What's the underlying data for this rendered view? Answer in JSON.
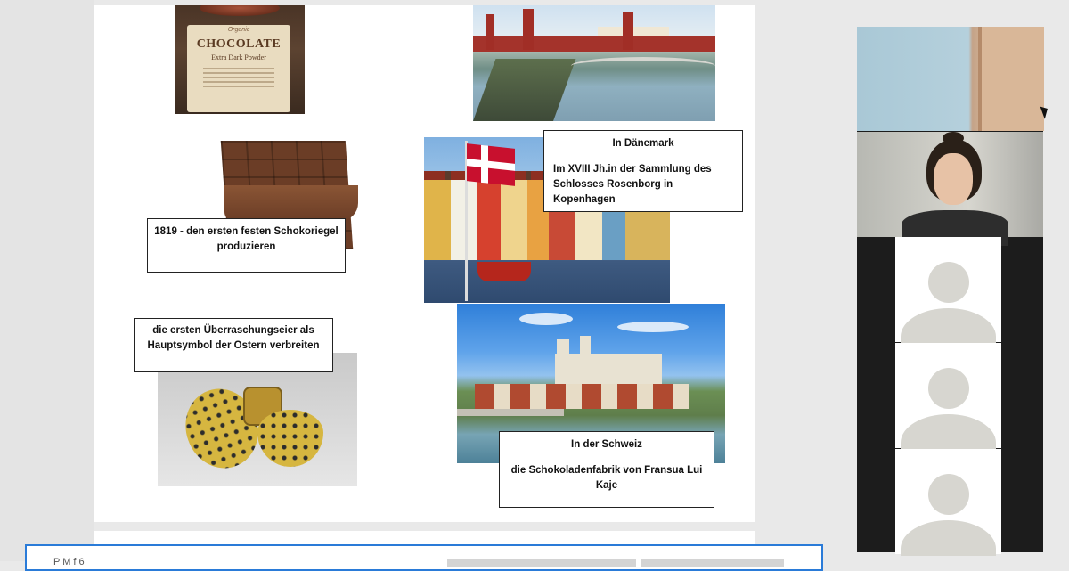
{
  "slide": {
    "chocolate_package": {
      "brand": "Organic",
      "title": "CHOCOLATE",
      "subtitle": "Extra Dark Powder"
    },
    "captions": {
      "bar_1819": "1819 - den ersten festen Schokoriegel produzieren",
      "easter_eggs": "die ersten Überraschungseier als Hauptsymbol der Ostern verbreiten",
      "denmark_title": "In Dänemark",
      "denmark_text": "Im XVIII Jh.in der Sammlung des Schlosses Rosenborg in Kopenhagen",
      "swiss_title": "In der Schweiz",
      "swiss_text": "die Schokoladenfabrik von Fransua Lui Kaje"
    }
  },
  "bottom_bar": {
    "partial_text": "P                                       M        f                6"
  },
  "participants": [
    {
      "kind": "camera-room"
    },
    {
      "kind": "camera-person"
    },
    {
      "kind": "avatar"
    },
    {
      "kind": "avatar"
    },
    {
      "kind": "avatar"
    }
  ],
  "colors": {
    "accent_border": "#2a7bd8",
    "slide_background": "#ffffff",
    "video_panel": "#1c1c1c"
  }
}
